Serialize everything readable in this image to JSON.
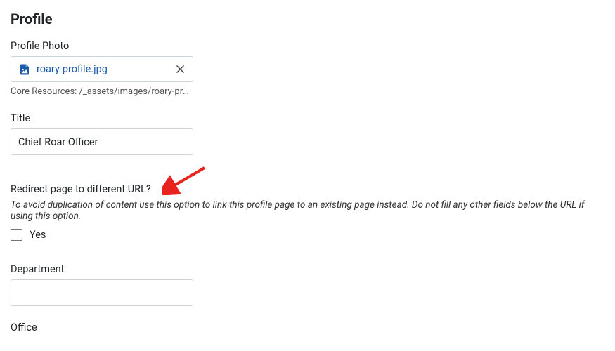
{
  "heading": "Profile",
  "photo": {
    "label": "Profile Photo",
    "filename": "roary-profile.jpg",
    "path": "Core Resources: /_assets/images/roary-profil…"
  },
  "title": {
    "label": "Title",
    "value": "Chief Roar Officer"
  },
  "redirect": {
    "label": "Redirect page to different URL?",
    "help": "To avoid duplication of content use this option to link this profile page to an existing page instead. Do not fill any other fields below the URL if using this option.",
    "checkbox_label": "Yes"
  },
  "department": {
    "label": "Department",
    "value": ""
  },
  "office": {
    "label": "Office",
    "value": ""
  }
}
